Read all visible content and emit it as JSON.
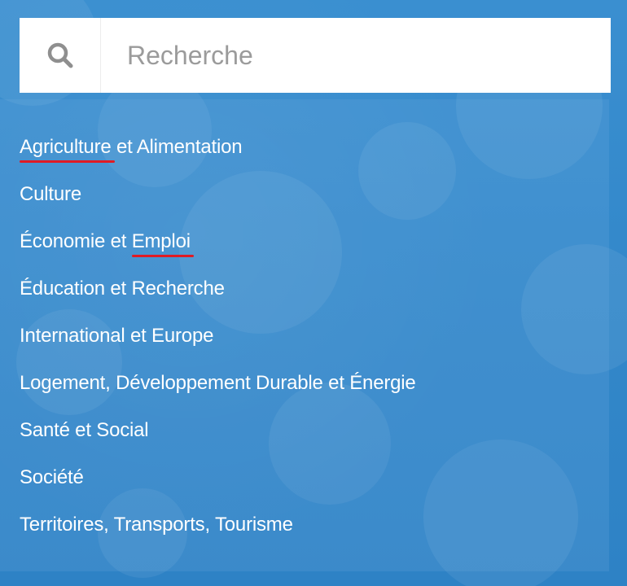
{
  "search": {
    "placeholder": "Recherche",
    "icon": "search-icon"
  },
  "menu": {
    "items": [
      {
        "parts": [
          "Agriculture",
          " et Alimentation"
        ],
        "underlined": "Agriculture"
      },
      {
        "parts": [
          "Culture"
        ]
      },
      {
        "parts": [
          "Économie et ",
          "Emploi"
        ],
        "underlined": "Emploi"
      },
      {
        "parts": [
          "Éducation et Recherche"
        ]
      },
      {
        "parts": [
          "International et Europe"
        ]
      },
      {
        "parts": [
          "Logement, Développement Durable et Énergie"
        ]
      },
      {
        "parts": [
          "Santé et Social"
        ]
      },
      {
        "parts": [
          "Société"
        ]
      },
      {
        "parts": [
          "Territoires, Transports, Tourisme"
        ]
      }
    ]
  },
  "colors": {
    "background": "#2f84c6",
    "panel_text": "#ffffff",
    "underline": "#e01b24",
    "search_background": "#ffffff",
    "placeholder": "#9b9b9b",
    "icon": "#8f8f8f"
  }
}
